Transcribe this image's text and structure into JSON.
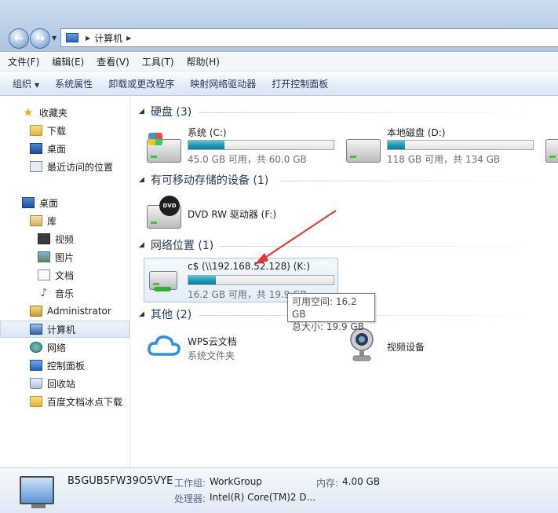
{
  "address": {
    "crumb": "计算机"
  },
  "menu": [
    "文件(F)",
    "编辑(E)",
    "查看(V)",
    "工具(T)",
    "帮助(H)"
  ],
  "commands": {
    "organize": "组织",
    "items": [
      "系统属性",
      "卸载或更改程序",
      "映射网络驱动器",
      "打开控制面板"
    ]
  },
  "sidebar": {
    "favorites": "收藏夹",
    "fav_items": [
      "下载",
      "桌面",
      "最近访问的位置"
    ],
    "desktop": "桌面",
    "library": "库",
    "lib_items": [
      "视频",
      "图片",
      "文档",
      "音乐"
    ],
    "other_items": [
      "Administrator",
      "计算机",
      "网络",
      "控制面板",
      "回收站",
      "百度文档冰点下载"
    ]
  },
  "groups": {
    "hdd": "硬盘 (3)",
    "removable": "有可移动存储的设备 (1)",
    "network": "网络位置 (1)",
    "other": "其他 (2)"
  },
  "drives": [
    {
      "name": "系统 (C:)",
      "free": "45.0 GB 可用，共 60.0 GB",
      "used_fraction": 0.25
    },
    {
      "name": "本地磁盘 (D:)",
      "free": "118 GB 可用，共 134 GB",
      "used_fraction": 0.12
    }
  ],
  "dvd": {
    "name": "DVD RW 驱动器 (F:)",
    "badge": "DVD"
  },
  "network_drive": {
    "name": "c$ (\\\\192.168.52.128) (K:)",
    "free": "16.2 GB 可用，共 19.9 GB",
    "used_fraction": 0.19
  },
  "tooltip": {
    "line1": "可用空间: 16.2 GB",
    "line2": "总大小: 19.9 GB"
  },
  "others": [
    {
      "name": "WPS云文档",
      "type": "系统文件夹"
    },
    {
      "name": "视频设备"
    }
  ],
  "details": {
    "computer_name": "B5GUB5FW39O5VYE",
    "workgroup_label": "工作组:",
    "workgroup": "WorkGroup",
    "memory_label": "内存:",
    "memory": "4.00 GB",
    "cpu_label": "处理器:",
    "cpu": "Intel(R) Core(TM)2 D..."
  },
  "colors": {
    "bar_fill": "#1c9cba",
    "arrow": "#e8342c",
    "header_text": "#1e395b"
  }
}
